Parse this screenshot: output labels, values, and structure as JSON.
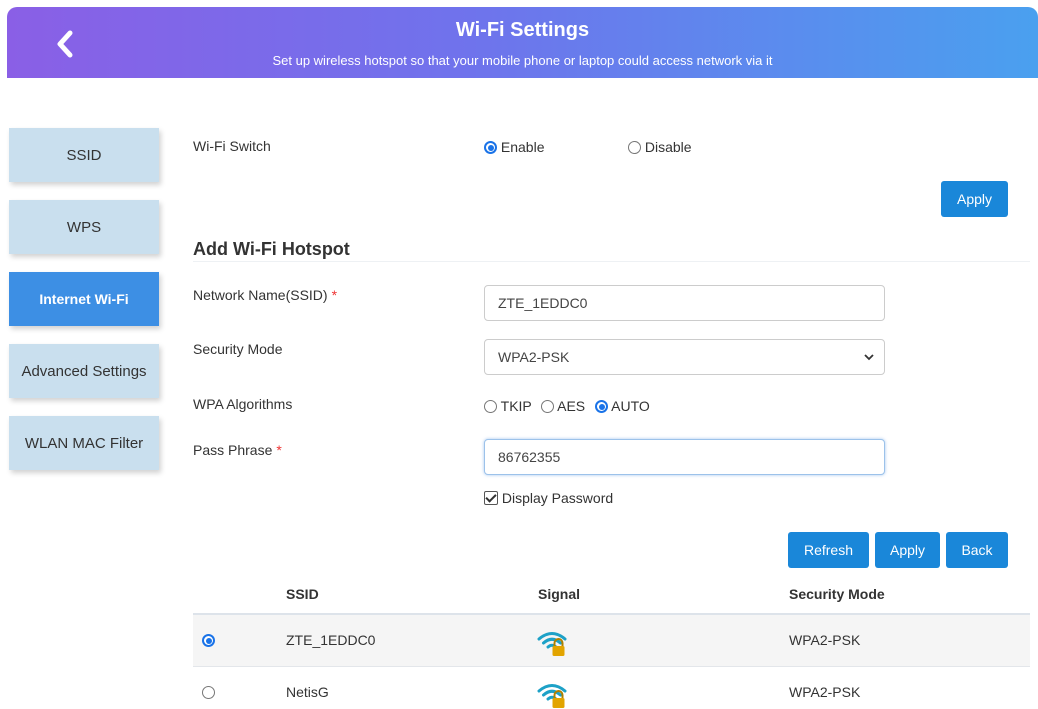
{
  "header": {
    "title": "Wi-Fi Settings",
    "subtitle": "Set up wireless hotspot so that your mobile phone or laptop could access network via it"
  },
  "sidebar": {
    "items": [
      {
        "label": "SSID"
      },
      {
        "label": "WPS"
      },
      {
        "label": "Internet Wi-Fi",
        "active": true
      },
      {
        "label": "Advanced Settings"
      },
      {
        "label": "WLAN MAC Filter"
      }
    ]
  },
  "wifi_switch": {
    "label": "Wi-Fi Switch",
    "options": [
      "Enable",
      "Disable"
    ],
    "selected": "Enable",
    "apply_label": "Apply"
  },
  "hotspot": {
    "title": "Add Wi-Fi Hotspot",
    "ssid_label": "Network Name(SSID)",
    "ssid_value": "ZTE_1EDDC0",
    "security_label": "Security Mode",
    "security_value": "WPA2-PSK",
    "algorithms_label": "WPA Algorithms",
    "algorithms": [
      "TKIP",
      "AES",
      "AUTO"
    ],
    "algorithm_selected": "AUTO",
    "pass_label": "Pass Phrase",
    "pass_value": "86762355",
    "required_mark": "*",
    "display_password_label": "Display Password",
    "display_password_checked": true
  },
  "actions": {
    "refresh": "Refresh",
    "apply": "Apply",
    "back": "Back"
  },
  "table": {
    "headers": [
      "SSID",
      "Signal",
      "Security Mode"
    ],
    "rows": [
      {
        "ssid": "ZTE_1EDDC0",
        "security": "WPA2-PSK",
        "selected": true,
        "signal_icon": "wifi-lock-icon"
      },
      {
        "ssid": "NetisG",
        "security": "WPA2-PSK",
        "selected": false,
        "signal_icon": "wifi-lock-icon"
      }
    ]
  },
  "colors": {
    "header_gradient_start": "#8a5fe6",
    "header_gradient_end": "#4aa0ef",
    "button": "#1a87d9",
    "sidebar_item": "#c9dfee",
    "sidebar_active": "#3d8fe4",
    "signal_icon": "#1da1c7",
    "lock_icon": "#e2a400"
  }
}
